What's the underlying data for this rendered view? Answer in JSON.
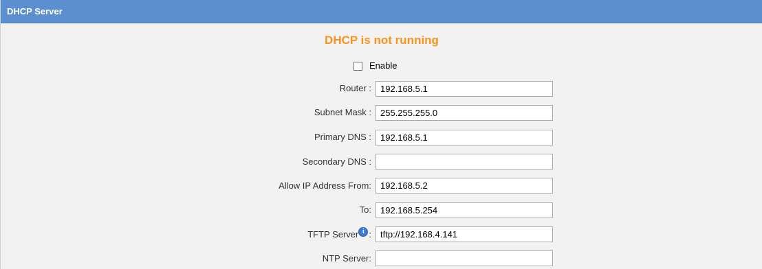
{
  "header": {
    "title": "DHCP Server"
  },
  "status": {
    "text": "DHCP is not running",
    "color": "#f7931e"
  },
  "enable": {
    "label": "Enable",
    "checked": false
  },
  "fields": {
    "router": {
      "label": "Router :",
      "value": "192.168.5.1"
    },
    "subnet_mask": {
      "label": "Subnet Mask :",
      "value": "255.255.255.0"
    },
    "primary_dns": {
      "label": "Primary DNS :",
      "value": "192.168.5.1"
    },
    "secondary_dns": {
      "label": "Secondary DNS :",
      "value": ""
    },
    "allow_from": {
      "label": "Allow IP Address From:",
      "value": "192.168.5.2"
    },
    "allow_to": {
      "label": "To:",
      "value": "192.168.5.254"
    },
    "tftp_server": {
      "label_text": "TFTP Server",
      "label_suffix": ":",
      "value": "tftp://192.168.4.141",
      "info_icon": "info-icon"
    },
    "ntp_server": {
      "label": "NTP Server:",
      "value": ""
    }
  },
  "colors": {
    "header_bg": "#5b8fd0",
    "panel_bg": "#f2f2f2",
    "status": "#f7931e"
  }
}
